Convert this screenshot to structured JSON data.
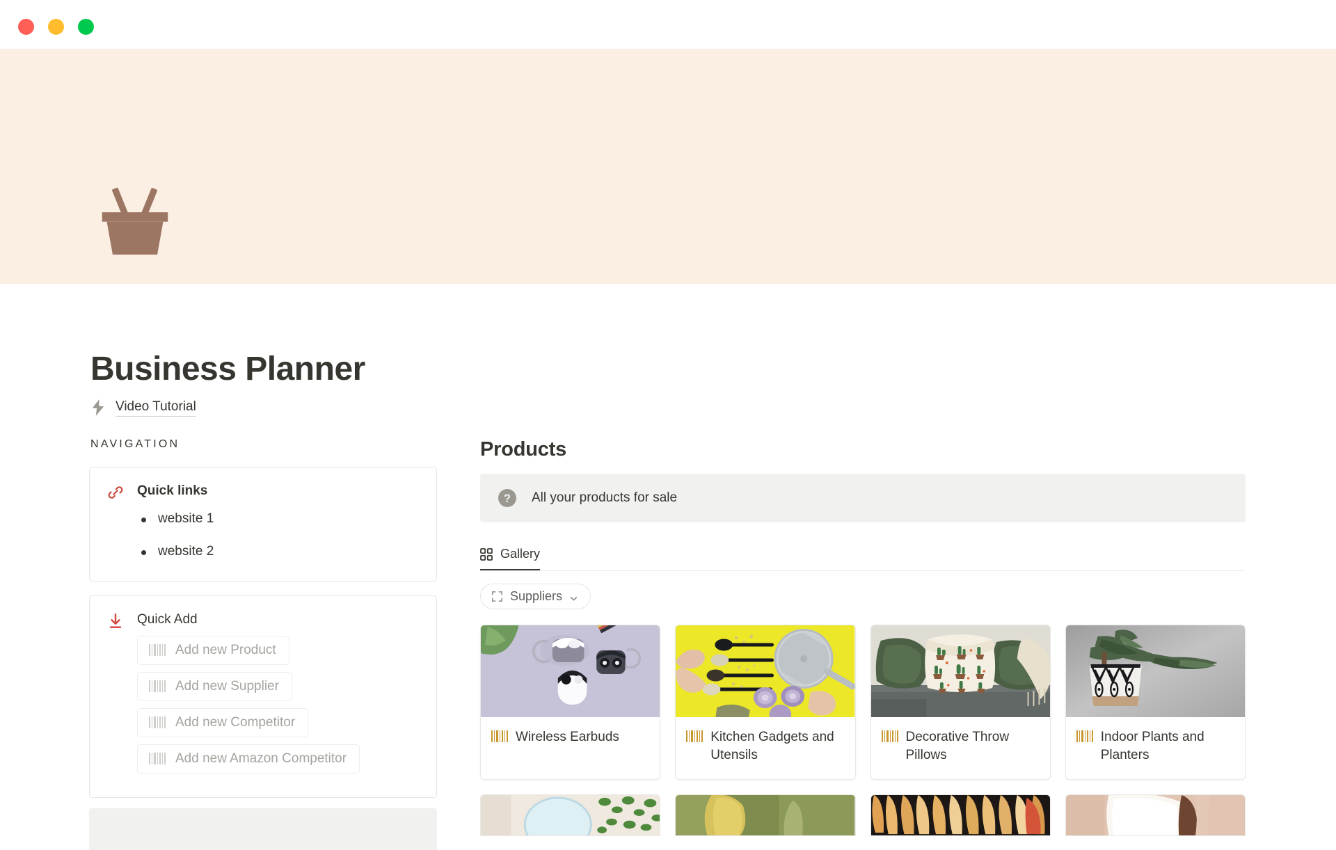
{
  "window": {
    "traffic_lights": [
      "close",
      "minimize",
      "maximize"
    ],
    "colors": {
      "close": "#ff5f57",
      "minimize": "#ffbd2e",
      "maximize": "#00ca4e"
    }
  },
  "cover": {
    "color": "#fbeee3"
  },
  "page": {
    "icon_name": "shopping-basket-icon",
    "icon_color": "#9c7563",
    "title": "Business Planner",
    "tutorial": {
      "icon": "lightning-bolt-icon",
      "label": "Video Tutorial"
    }
  },
  "navigation": {
    "section_label": "NAVIGATION",
    "quick_links": {
      "icon": "link-icon",
      "icon_color": "#c9443b",
      "title": "Quick links",
      "items": [
        {
          "label": "website 1"
        },
        {
          "label": "website 2"
        }
      ]
    },
    "quick_add": {
      "icon": "download-arrow-icon",
      "icon_color": "#d4453b",
      "title": "Quick Add",
      "buttons": [
        {
          "icon": "barcode-icon",
          "label": "Add new Product"
        },
        {
          "icon": "barcode-icon",
          "label": "Add new Supplier"
        },
        {
          "icon": "barcode-icon",
          "label": "Add new Competitor"
        },
        {
          "icon": "barcode-icon",
          "label": "Add new Amazon Competitor"
        }
      ]
    }
  },
  "products": {
    "title": "Products",
    "callout": {
      "icon": "question-circle-icon",
      "text": "All your products for sale"
    },
    "tabs": [
      {
        "icon": "gallery-grid-icon",
        "label": "Gallery",
        "active": true
      }
    ],
    "filters": [
      {
        "icon": "bracket-icon",
        "label": "Suppliers",
        "chevron": "chevron-down-icon"
      }
    ],
    "cards": [
      {
        "icon": "barcode-icon",
        "label": "Wireless Earbuds",
        "image": "wireless-earbuds-photo"
      },
      {
        "icon": "barcode-icon",
        "label": "Kitchen Gadgets and Utensils",
        "image": "kitchen-gadgets-photo"
      },
      {
        "icon": "barcode-icon",
        "label": "Decorative Throw Pillows",
        "image": "throw-pillows-photo"
      },
      {
        "icon": "barcode-icon",
        "label": "Indoor Plants and Planters",
        "image": "indoor-plants-photo"
      }
    ],
    "cards_row2": [
      {
        "image": "bathroom-mirror-photo"
      },
      {
        "image": "yellow-clothing-photo"
      },
      {
        "image": "wood-hangers-photo"
      },
      {
        "image": "white-apparel-photo"
      }
    ]
  },
  "accent_colors": {
    "barcode_gold": "#c8972e",
    "barcode_gray": "#cfcdc9",
    "callout_bg": "#f1f1ef",
    "tab_underline": "#37352f"
  }
}
